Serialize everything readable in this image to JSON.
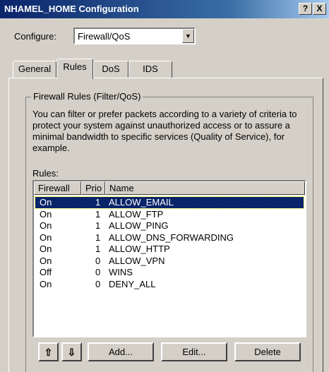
{
  "window": {
    "title": "NHAMEL_HOME Configuration",
    "help_label": "?",
    "close_label": "X"
  },
  "configure": {
    "label": "Configure:",
    "value": "Firewall/QoS",
    "arrow": "▼"
  },
  "tabs": [
    {
      "label": "General"
    },
    {
      "label": "Rules",
      "active": true
    },
    {
      "label": "DoS"
    },
    {
      "label": "IDS"
    }
  ],
  "group": {
    "title": "Firewall Rules (Filter/QoS)",
    "description": "You can filter or prefer packets according to a variety of criteria to protect your system against unauthorized access or to assure a minimal bandwidth to specific services (Quality of Service), for example."
  },
  "rules": {
    "label": "Rules:",
    "columns": [
      "Firewall",
      "Prio",
      "Name"
    ],
    "rows": [
      {
        "firewall": "On",
        "prio": "1",
        "name": "ALLOW_EMAIL",
        "selected": true
      },
      {
        "firewall": "On",
        "prio": "1",
        "name": "ALLOW_FTP"
      },
      {
        "firewall": "On",
        "prio": "1",
        "name": "ALLOW_PING"
      },
      {
        "firewall": "On",
        "prio": "1",
        "name": "ALLOW_DNS_FORWARDING"
      },
      {
        "firewall": "On",
        "prio": "1",
        "name": "ALLOW_HTTP"
      },
      {
        "firewall": "On",
        "prio": "0",
        "name": "ALLOW_VPN"
      },
      {
        "firewall": "Off",
        "prio": "0",
        "name": "WINS"
      },
      {
        "firewall": "On",
        "prio": "0",
        "name": "DENY_ALL"
      }
    ]
  },
  "buttons": {
    "move_up": "⇧",
    "move_down": "⇩",
    "add": "Add...",
    "edit": "Edit...",
    "delete": "Delete"
  },
  "colors": {
    "titlebar": "#0a246a",
    "selection": "#0a246a",
    "face": "#d4d0c8"
  }
}
